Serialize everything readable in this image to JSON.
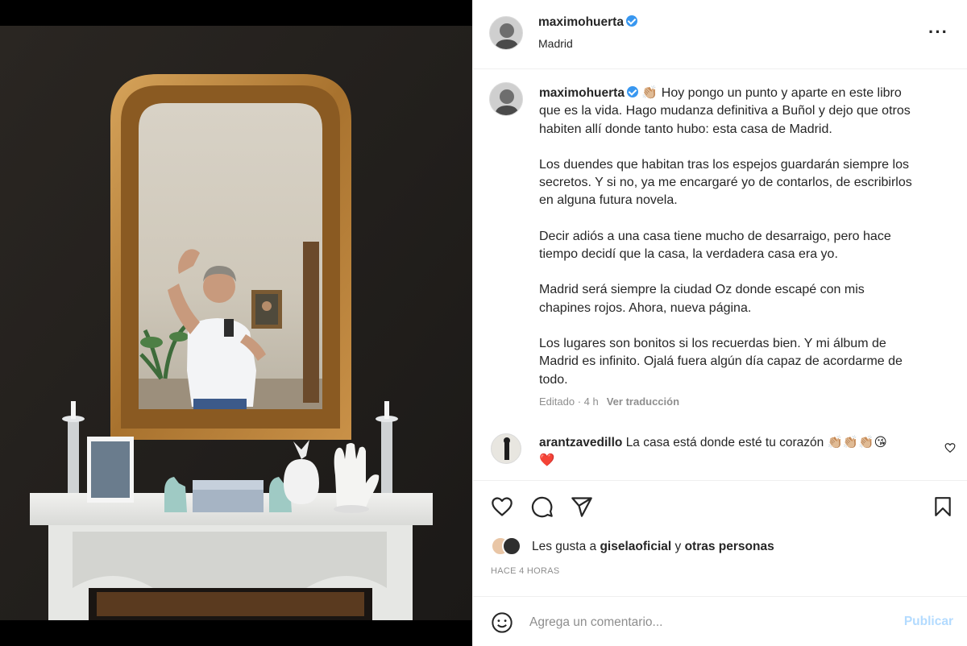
{
  "post": {
    "username": "maximohuerta",
    "location": "Madrid",
    "caption_lines": [
      "Hoy pongo un punto y aparte en este libro",
      "que es la vida. Hago mudanza definitiva a Buñol y dejo que otros",
      "habiten allí donde tanto hubo: esta casa de Madrid."
    ],
    "caption_paragraphs": [
      "Los duendes que habitan tras los espejos guardarán siempre los\nsecretos. Y si no, ya me encargaré yo de contarlos, de escribirlos\nen alguna futura novela.",
      "Decir adiós a una casa tiene mucho de desarraigo, pero hace\ntiempo decidí que la casa, la verdadera casa era yo.",
      "Madrid será siempre la ciudad Oz donde escapé con mis\nchapines rojos. Ahora, nueva página.",
      "Los lugares son bonitos si los recuerdas bien. Y mi álbum de\nMadrid es infinito. Ojalá fuera algún día capaz de acordarme de\ntodo."
    ],
    "caption_emoji": "👏🏼",
    "edited_label": "Editado · 4 h",
    "translate_label": "Ver traducción"
  },
  "comment": {
    "username": "arantzavedillo",
    "text": "La casa está donde esté tu corazón",
    "emojis": "👏🏼👏🏼👏🏼😘",
    "emoji_line2": "❤️"
  },
  "likes": {
    "prefix": "Les gusta a",
    "user": "giselaoficial",
    "connector": "y",
    "others": "otras personas"
  },
  "timestamp": "HACE 4 HORAS",
  "add_comment": {
    "placeholder": "Agrega un comentario...",
    "publish_label": "Publicar"
  },
  "icons": {
    "more": "more-options-icon",
    "like": "heart-icon",
    "comment": "comment-icon",
    "share": "share-icon",
    "save": "bookmark-icon",
    "emoji": "emoji-icon",
    "verified": "verified-badge-icon"
  },
  "colors": {
    "verified": "#3897f0",
    "text": "#262626",
    "muted": "#8e8e8e",
    "publish_disabled": "#b3dbff",
    "heart_red": "#ed4956"
  }
}
